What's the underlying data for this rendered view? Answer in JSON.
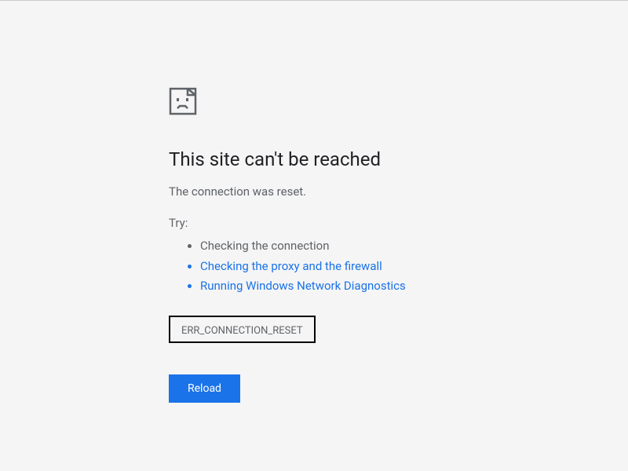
{
  "error": {
    "title": "This site can't be reached",
    "message": "The connection was reset.",
    "tryLabel": "Try:",
    "suggestions": [
      {
        "text": "Checking the connection",
        "isLink": false
      },
      {
        "text": "Checking the proxy and the firewall",
        "isLink": true
      },
      {
        "text": "Running Windows Network Diagnostics",
        "isLink": true
      }
    ],
    "code": "ERR_CONNECTION_RESET",
    "reloadLabel": "Reload"
  }
}
